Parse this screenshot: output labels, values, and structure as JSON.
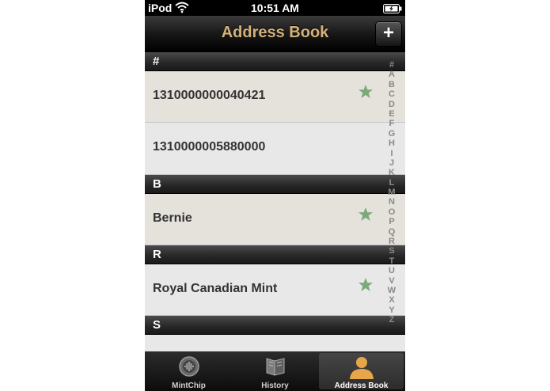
{
  "status_bar": {
    "carrier": "iPod",
    "time": "10:51 AM"
  },
  "navbar": {
    "title": "Address Book",
    "add_label": "+"
  },
  "sections": [
    {
      "header": "#",
      "rows": [
        {
          "name": "1310000000040421",
          "starred": true
        },
        {
          "name": "1310000005880000",
          "starred": false
        }
      ]
    },
    {
      "header": "B",
      "rows": [
        {
          "name": "Bernie",
          "starred": true
        }
      ]
    },
    {
      "header": "R",
      "rows": [
        {
          "name": "Royal Canadian Mint",
          "starred": true
        }
      ]
    },
    {
      "header": "S",
      "rows": []
    }
  ],
  "index_letters": [
    "#",
    "A",
    "B",
    "C",
    "D",
    "E",
    "F",
    "G",
    "H",
    "I",
    "J",
    "K",
    "L",
    "M",
    "N",
    "O",
    "P",
    "Q",
    "R",
    "S",
    "T",
    "U",
    "V",
    "W",
    "X",
    "Y",
    "Z"
  ],
  "tabs": [
    {
      "label": "MintChip",
      "icon": "mintchip-icon",
      "selected": false
    },
    {
      "label": "History",
      "icon": "history-icon",
      "selected": false
    },
    {
      "label": "Address Book",
      "icon": "person-icon",
      "selected": true
    }
  ],
  "colors": {
    "title": "#d4b17a",
    "star": "#7aa97a",
    "row_beige": "#e4e2db",
    "row_grey": "#e8e8e8"
  }
}
